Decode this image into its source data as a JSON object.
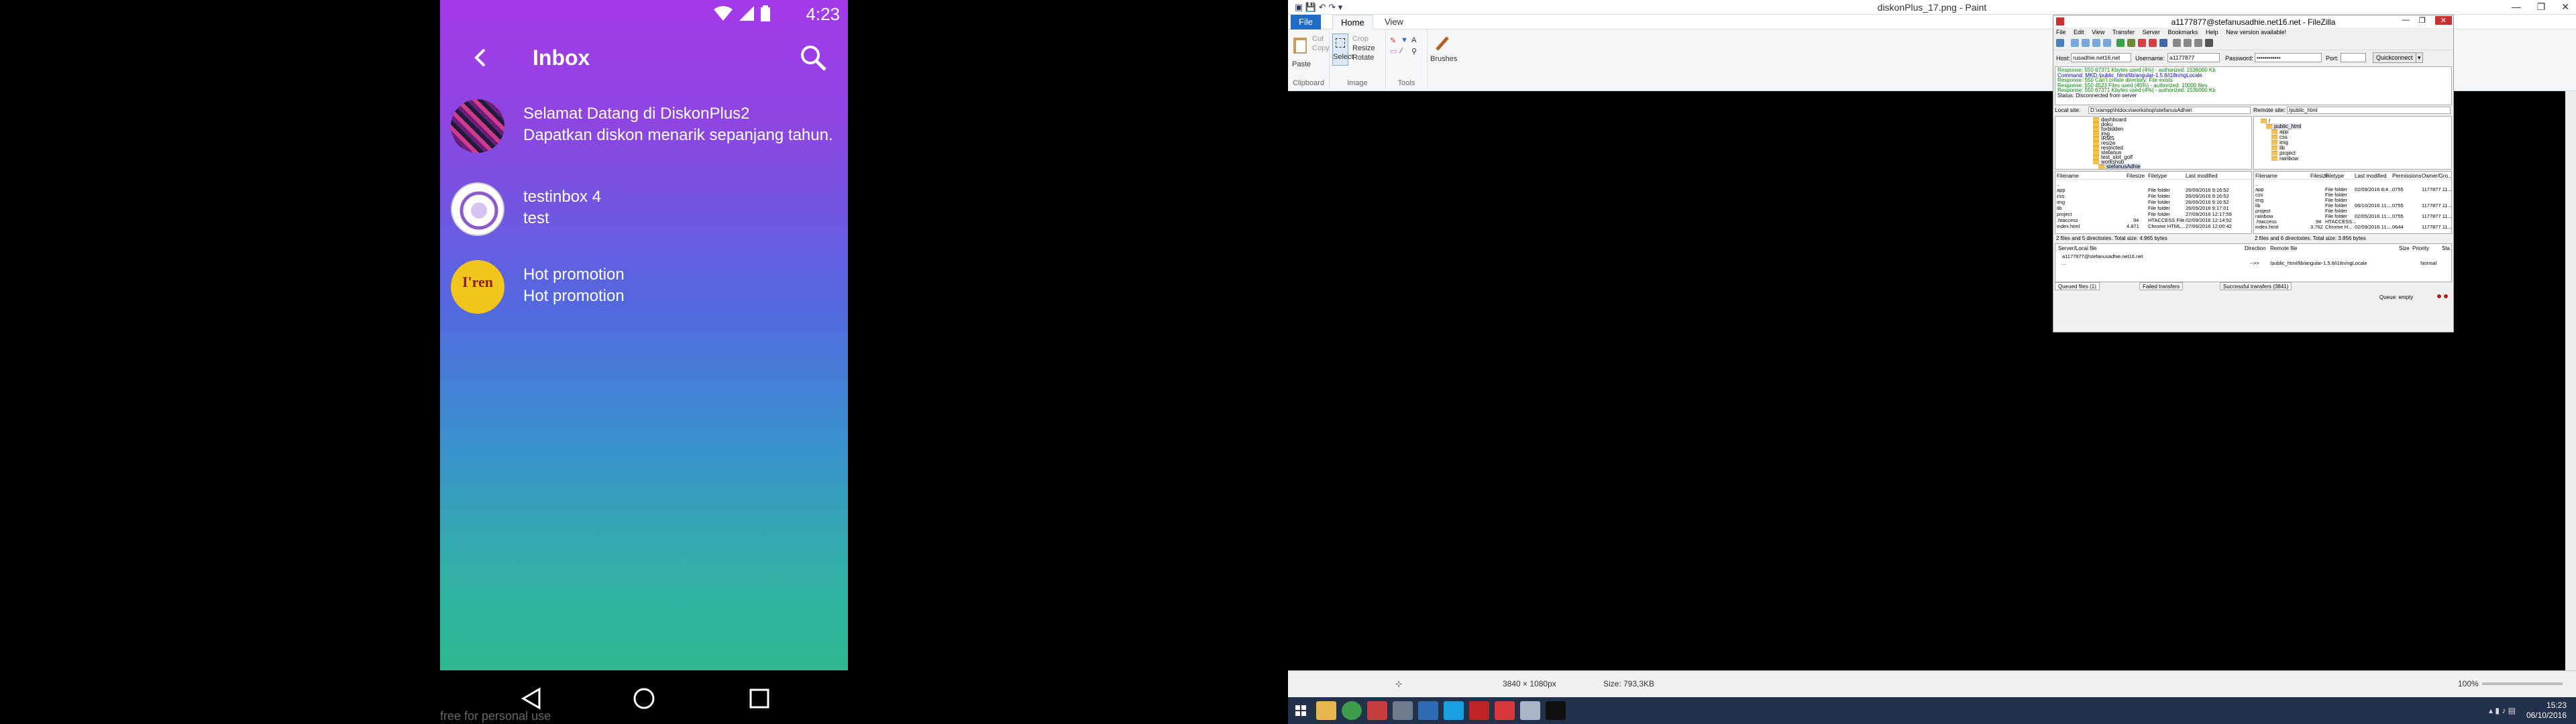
{
  "phone": {
    "status_time": "4:23",
    "title": "Inbox",
    "messages": [
      {
        "title": "Selamat Datang di DiskonPlus2",
        "body": "Dapatkan diskon menarik sepanjang tahun."
      },
      {
        "title": "testinbox 4",
        "body": "test"
      },
      {
        "title": "Hot promotion",
        "body": "Hot promotion"
      }
    ],
    "avatar3_text": "I'ren",
    "watermark": "free for personal use"
  },
  "paint": {
    "title": "diskonPlus_17.png - Paint",
    "tabs": [
      "File",
      "Home",
      "View"
    ],
    "ribbon": {
      "paste": "Paste",
      "cut": "Cut",
      "copy": "Copy",
      "clipboard": "Clipboard",
      "select": "Select",
      "crop": "Crop",
      "resize": "Resize",
      "rotate": "Rotate",
      "image": "Image",
      "tools": "Tools",
      "brushes": "Brushes"
    },
    "status": {
      "dimensions": "3840 × 1080px",
      "size": "Size: 793,3KB",
      "zoom": "100%"
    }
  },
  "filezilla": {
    "title": "a1177877@stefanusadhie.net16.net - FileZilla",
    "menu": [
      "File",
      "Edit",
      "View",
      "Transfer",
      "Server",
      "Bookmarks",
      "Help",
      "New version available!"
    ],
    "quickconnect": {
      "host_label": "Host:",
      "host": "rusadhie.net16.net",
      "user_label": "Username:",
      "user": "a1177877",
      "pass_label": "Password:",
      "pass": "••••••••••••",
      "port_label": "Port:",
      "port": "",
      "button": "Quickconnect"
    },
    "log": [
      "Response:   550 67371 Kbytes used (4%) - authorized: 1536000 Kb",
      "Command:   MKD /public_html/lib/angular-1.5.8/i18n/ngLocale",
      "Response:   550 Can't create directory: File exists",
      "Response:   550 4523 Files used (45%) - authorized: 10000 files",
      "Response:   550 67371 Kbytes used (4%) - authorized: 1536000 Kb",
      "Status:       Disconnected from server"
    ],
    "local_site_label": "Local site:",
    "local_site": "D:\\xampp\\htdocs\\workshop\\stefanusAdhie\\",
    "remote_site_label": "Remote site:",
    "remote_site": "/public_html",
    "local_tree": [
      "dashboard",
      "doku",
      "forbidden",
      "img",
      "IRMS",
      "resize",
      "restricted",
      "stefanus",
      "test_slot_golf",
      "workshop",
      "stefanusAdhie"
    ],
    "remote_tree": [
      "/",
      "public_html",
      "app",
      "css",
      "img",
      "lib",
      "project",
      "rainbow"
    ],
    "local_headers": [
      "Filename",
      "Filesize",
      "Filetype",
      "Last modified"
    ],
    "local_files": [
      {
        "name": "..",
        "size": "",
        "type": "",
        "mod": ""
      },
      {
        "name": "app",
        "size": "",
        "type": "File folder",
        "mod": "26/09/2016 9:16:52"
      },
      {
        "name": "css",
        "size": "",
        "type": "File folder",
        "mod": "26/09/2016 9:16:52"
      },
      {
        "name": "img",
        "size": "",
        "type": "File folder",
        "mod": "26/09/2016 9:16:52"
      },
      {
        "name": "lib",
        "size": "",
        "type": "File folder",
        "mod": "26/09/2016 9:17:01"
      },
      {
        "name": "project",
        "size": "",
        "type": "File folder",
        "mod": "27/09/2016 12:17:59"
      },
      {
        "name": ".htaccess",
        "size": "94",
        "type": "HTACCESS File",
        "mod": "02/09/2016 12:14:52"
      },
      {
        "name": "index.html",
        "size": "4.871",
        "type": "Chrome HTML...",
        "mod": "27/09/2016 12:00:42"
      }
    ],
    "local_summary": "2 files and 5 directories. Total size: 4.965 bytes",
    "remote_headers": [
      "Filename",
      "Filesize",
      "Filetype",
      "Last modified",
      "Permissions",
      "Owner/Gro..."
    ],
    "remote_files": [
      {
        "name": "..",
        "size": "",
        "type": "",
        "mod": "",
        "perm": "",
        "owner": ""
      },
      {
        "name": "app",
        "size": "",
        "type": "File folder",
        "mod": "02/09/2016 8:4...",
        "perm": "0755",
        "owner": "1177877 11..."
      },
      {
        "name": "css",
        "size": "",
        "type": "File folder",
        "mod": "",
        "perm": "",
        "owner": ""
      },
      {
        "name": "img",
        "size": "",
        "type": "File folder",
        "mod": "",
        "perm": "",
        "owner": ""
      },
      {
        "name": "lib",
        "size": "",
        "type": "File folder",
        "mod": "06/10/2016 11:...",
        "perm": "0755",
        "owner": "1177877 11..."
      },
      {
        "name": "project",
        "size": "",
        "type": "File folder",
        "mod": "",
        "perm": "",
        "owner": ""
      },
      {
        "name": "rainbow",
        "size": "",
        "type": "File folder",
        "mod": "02/05/2016 11:...",
        "perm": "0755",
        "owner": "1177877 11..."
      },
      {
        "name": ".htaccess",
        "size": "94",
        "type": "HTACCESS...",
        "mod": "",
        "perm": "",
        "owner": ""
      },
      {
        "name": "index.html",
        "size": "3.762",
        "type": "Chrome H...",
        "mod": "02/09/2016 11:...",
        "perm": "0644",
        "owner": "1177877 11..."
      }
    ],
    "remote_summary": "2 files and 6 directories. Total size: 3.856 bytes",
    "queue_headers": [
      "Server/Local file",
      "Direction",
      "Remote file",
      "Size",
      "Priority",
      "Sta"
    ],
    "queue_server": "a1177877@stefanusadhie.net16.net",
    "queue_item": {
      "local": "...",
      "direction": "-->>",
      "remote": "/public_html/lib/angular-1.5.8/i18n/ngLocale",
      "priority": "Normal"
    },
    "queue_tabs": [
      "Queued files (1)",
      "Failed transfers",
      "Successful transfers (3841)"
    ],
    "queue_status": "Queue: empty"
  },
  "taskbar": {
    "time": "15:23",
    "date": "06/10/2016"
  }
}
